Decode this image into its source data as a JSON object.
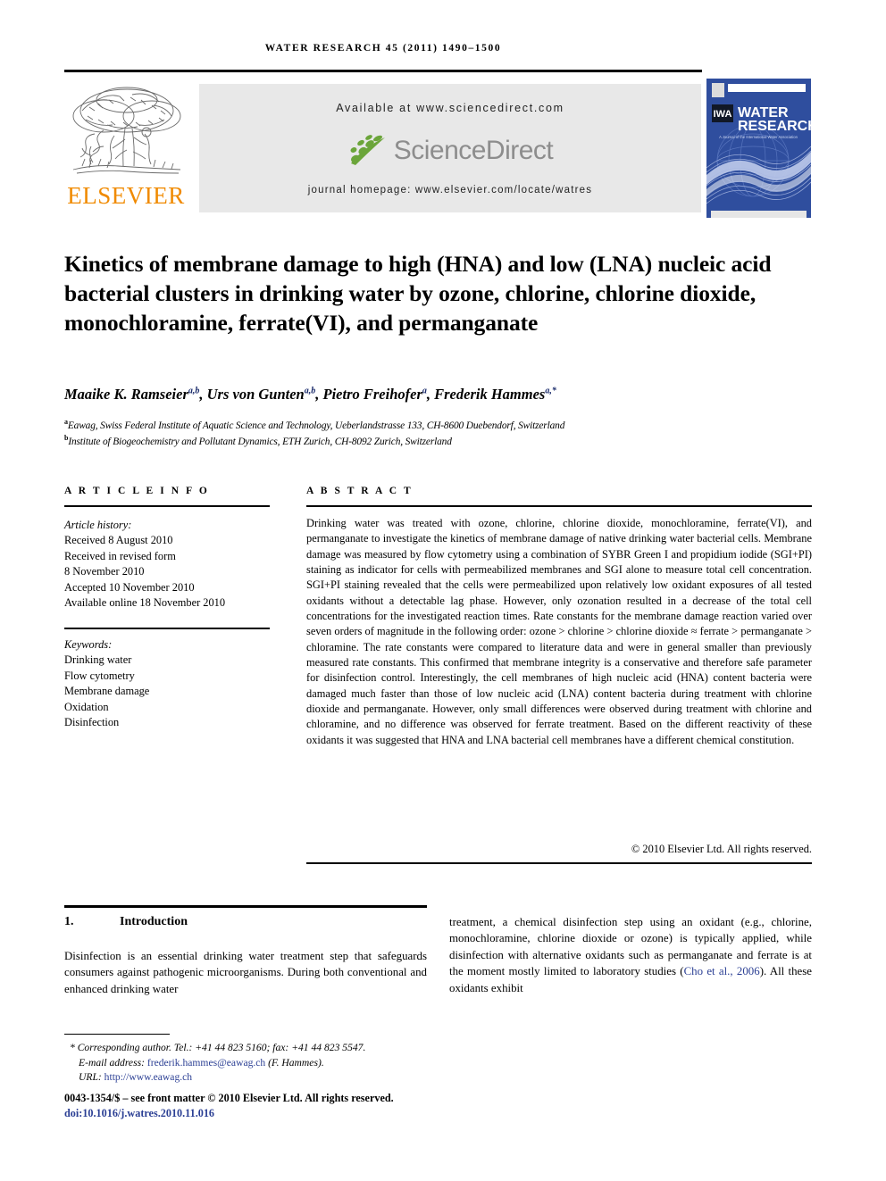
{
  "running_head": "WATER RESEARCH 45 (2011) 1490–1500",
  "masthead": {
    "publisher": "ELSEVIER",
    "available_at": "Available at www.sciencedirect.com",
    "sciencedirect_word": "ScienceDirect",
    "journal_homepage": "journal homepage: www.elsevier.com/locate/watres",
    "cover_title_line1": "WATER",
    "cover_title_line2": "RESEARCH",
    "cover_subtitle": "A Journal of the International Water Association",
    "cover_badge": "IWA",
    "colors": {
      "elsevier_orange": "#f08a00",
      "sciencedirect_green": "#6ba53a",
      "sciencedirect_gray": "#8d8d8d",
      "band_gray": "#e8e8e8",
      "cover_blue": "#2f4e9e",
      "link_blue": "#2b3f94"
    }
  },
  "article": {
    "title": "Kinetics of membrane damage to high (HNA) and low (LNA) nucleic acid bacterial clusters in drinking water by ozone, chlorine, chlorine dioxide, monochloramine, ferrate(VI), and permanganate",
    "authors_html": "Maaike K. Ramseier<sup>a,b</sup>, Urs von Gunten<sup>a,b</sup>, Pietro Freihofer<sup>a</sup>, Frederik Hammes<sup>a,*</sup>",
    "affiliation_a": "Eawag, Swiss Federal Institute of Aquatic Science and Technology, Ueberlandstrasse 133, CH-8600 Duebendorf, Switzerland",
    "affiliation_b": "Institute of Biogeochemistry and Pollutant Dynamics, ETH Zurich, CH-8092 Zurich, Switzerland"
  },
  "article_info": {
    "heading": "A R T I C L E   I N F O",
    "history_label": "Article history:",
    "history": [
      "Received 8 August 2010",
      "Received in revised form",
      "8 November 2010",
      "Accepted 10 November 2010",
      "Available online 18 November 2010"
    ],
    "keywords_label": "Keywords:",
    "keywords": [
      "Drinking water",
      "Flow cytometry",
      "Membrane damage",
      "Oxidation",
      "Disinfection"
    ]
  },
  "abstract": {
    "heading": "A B S T R A C T",
    "text": "Drinking water was treated with ozone, chlorine, chlorine dioxide, monochloramine, ferrate(VI), and permanganate to investigate the kinetics of membrane damage of native drinking water bacterial cells. Membrane damage was measured by flow cytometry using a combination of SYBR Green I and propidium iodide (SGI+PI) staining as indicator for cells with permeabilized membranes and SGI alone to measure total cell concentration. SGI+PI staining revealed that the cells were permeabilized upon relatively low oxidant exposures of all tested oxidants without a detectable lag phase. However, only ozonation resulted in a decrease of the total cell concentrations for the investigated reaction times. Rate constants for the membrane damage reaction varied over seven orders of magnitude in the following order: ozone > chlorine > chlorine dioxide ≈ ferrate > permanganate > chloramine. The rate constants were compared to literature data and were in general smaller than previously measured rate constants. This confirmed that membrane integrity is a conservative and therefore safe parameter for disinfection control. Interestingly, the cell membranes of high nucleic acid (HNA) content bacteria were damaged much faster than those of low nucleic acid (LNA) content bacteria during treatment with chlorine dioxide and permanganate. However, only small differences were observed during treatment with chlorine and chloramine, and no difference was observed for ferrate treatment. Based on the different reactivity of these oxidants it was suggested that HNA and LNA bacterial cell membranes have a different chemical constitution.",
    "copyright": "© 2010 Elsevier Ltd. All rights reserved."
  },
  "section": {
    "number": "1.",
    "title": "Introduction",
    "left_text": "Disinfection is an essential drinking water treatment step that safeguards consumers against pathogenic microorganisms. During both conventional and enhanced drinking water",
    "right_before_cite": "treatment, a chemical disinfection step using an oxidant (e.g., chlorine, monochloramine, chlorine dioxide or ozone) is typically applied, while disinfection with alternative oxidants such as permanganate and ferrate is at the moment mostly limited to laboratory studies (",
    "right_citation": "Cho et al., 2006",
    "right_after_cite": "). All these oxidants exhibit"
  },
  "footnotes": {
    "corresponding_marker": "*",
    "corresponding": "Corresponding author. Tel.: +41 44 823 5160; fax: +41 44 823 5547.",
    "email_label": "E-mail address:",
    "email": "frederik.hammes@eawag.ch",
    "email_suffix": "(F. Hammes).",
    "url_label": "URL:",
    "url": "http://www.eawag.ch",
    "front_matter": "0043-1354/$ – see front matter © 2010 Elsevier Ltd. All rights reserved.",
    "doi": "doi:10.1016/j.watres.2010.11.016"
  }
}
